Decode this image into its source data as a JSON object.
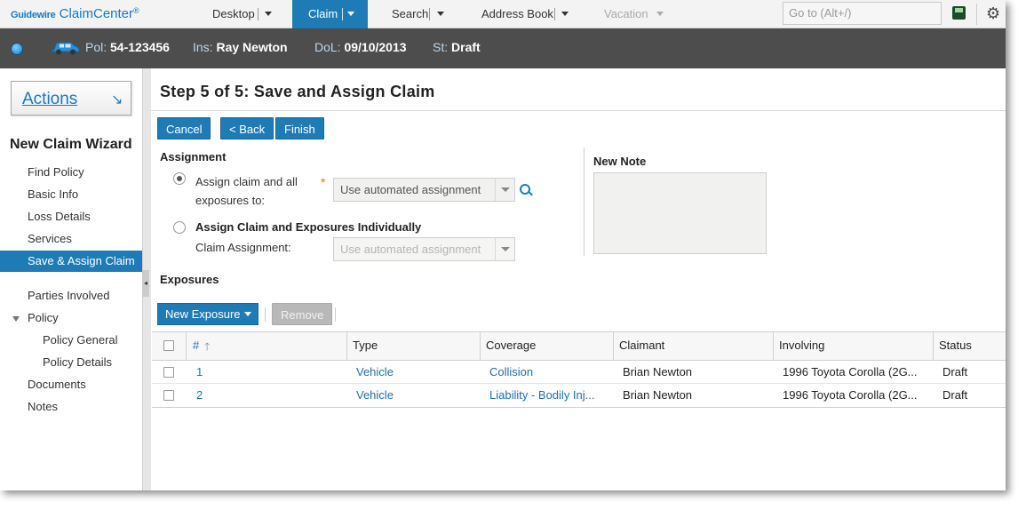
{
  "app": {
    "logo_prefix": "Guidewire",
    "logo_name": "ClaimCenter",
    "logo_mark": "®"
  },
  "topnav": {
    "tabs": [
      "Desktop",
      "Claim",
      "Search",
      "Address Book",
      "Vacation"
    ],
    "goto_placeholder": "Go to (Alt+/)"
  },
  "infobar": {
    "pol_label": "Pol:",
    "pol_value": "54-123456",
    "ins_label": "Ins:",
    "ins_value": "Ray Newton",
    "dol_label": "DoL:",
    "dol_value": "09/10/2013",
    "st_label": "St:",
    "st_value": "Draft"
  },
  "sidebar": {
    "actions_label": "Actions",
    "wizard_title": "New Claim Wizard",
    "items": [
      "Find Policy",
      "Basic Info",
      "Loss Details",
      "Services",
      "Save & Assign Claim",
      "Parties Involved",
      "Policy",
      "Policy General",
      "Policy Details",
      "Documents",
      "Notes"
    ],
    "active_item": "Save & Assign Claim"
  },
  "main": {
    "title": "Step 5 of 5: Save and Assign Claim",
    "buttons": {
      "cancel": "Cancel",
      "back": "< Back",
      "finish": "Finish"
    },
    "assignment": {
      "heading": "Assignment",
      "option1_line1": "Assign claim and all",
      "option1_line2": "exposures to:",
      "option1_select": "Use automated assignment",
      "option2_label": "Assign Claim and Exposures Individually",
      "claim_assignment_label": "Claim Assignment:",
      "option2_select": "Use automated assignment",
      "selected_option": 1
    },
    "note": {
      "heading": "New Note",
      "value": ""
    },
    "exposures": {
      "heading": "Exposures",
      "new_label": "New Exposure",
      "remove_label": "Remove",
      "columns": [
        "#",
        "Type",
        "Coverage",
        "Claimant",
        "Involving",
        "Status"
      ],
      "rows": [
        {
          "num": "1",
          "type": "Vehicle",
          "coverage": "Collision",
          "claimant": "Brian Newton",
          "involving": "1996 Toyota Corolla (2G...",
          "status": "Draft"
        },
        {
          "num": "2",
          "type": "Vehicle",
          "coverage": "Liability - Bodily Inj...",
          "claimant": "Brian Newton",
          "involving": "1996 Toyota Corolla (2G...",
          "status": "Draft"
        }
      ]
    }
  },
  "colors": {
    "accent": "#1f7bb6",
    "infobar_bg": "#4d4d4d"
  }
}
